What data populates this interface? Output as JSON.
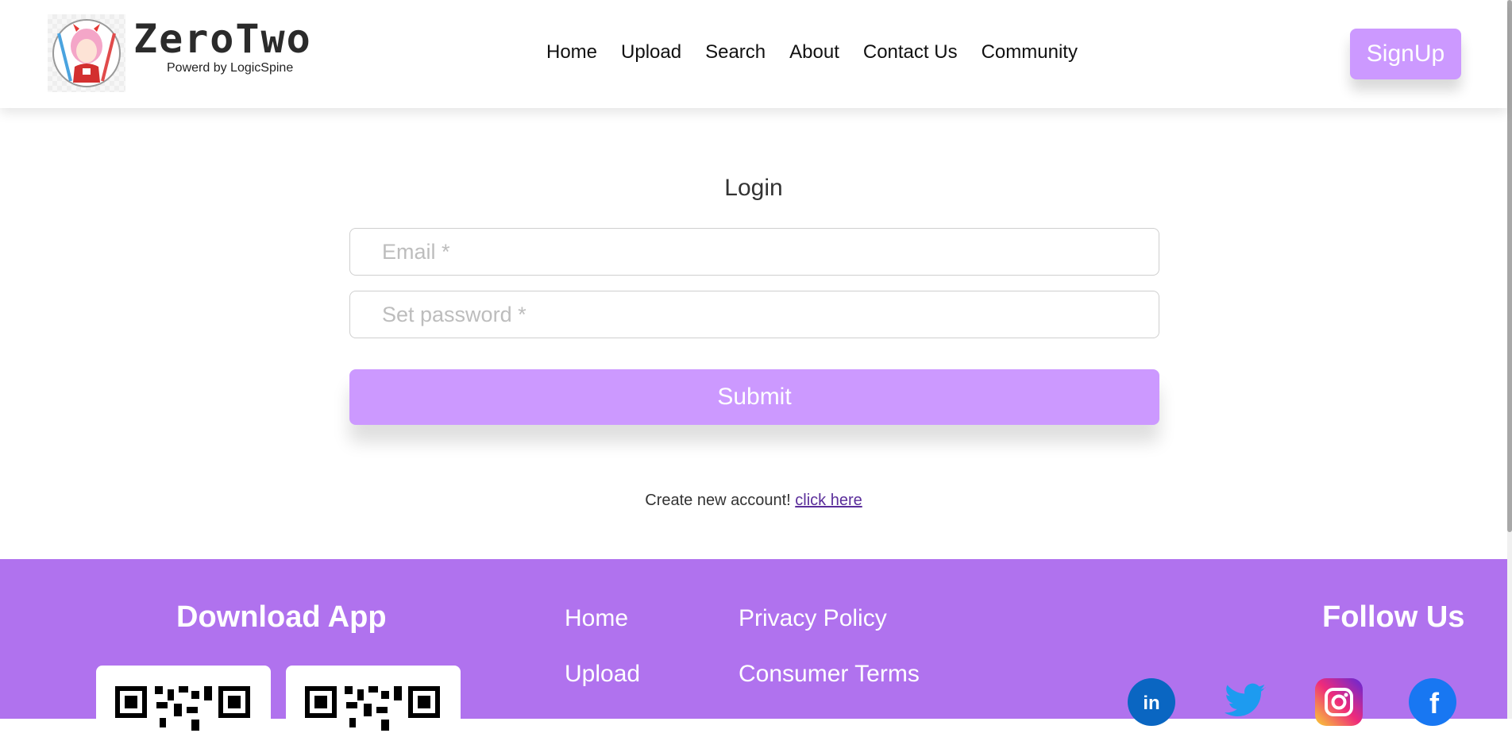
{
  "header": {
    "brand": "ZeroTwo",
    "brand_sub": "Powerd by LogicSpine",
    "nav": [
      "Home",
      "Upload",
      "Search",
      "About",
      "Contact Us",
      "Community"
    ],
    "signup_label": "SignUp"
  },
  "login": {
    "title": "Login",
    "email_placeholder": "Email *",
    "password_placeholder": "Set password *",
    "submit_label": "Submit",
    "create_text": "Create new account!",
    "create_link": "click here"
  },
  "footer": {
    "download_title": "Download App",
    "links_col1": [
      "Home",
      "Upload"
    ],
    "links_col2": [
      "Privacy Policy",
      "Consumer Terms"
    ],
    "follow_title": "Follow Us",
    "social_icons": [
      "linkedin-icon",
      "twitter-icon",
      "instagram-icon",
      "facebook-icon"
    ]
  },
  "colors": {
    "accent": "#cc99ff",
    "footer_bg": "#b072ee",
    "linkedin": "#0a66c2",
    "twitter": "#1d9bf0",
    "facebook": "#1877f2"
  }
}
